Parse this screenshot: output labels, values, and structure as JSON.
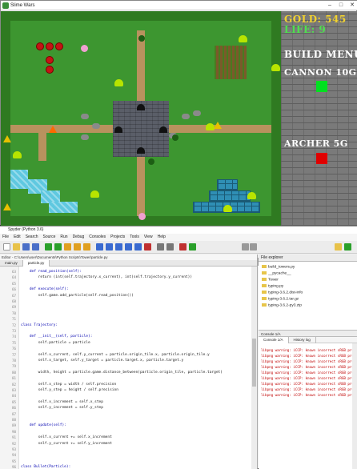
{
  "game_window": {
    "title": "Slime Wars",
    "controls": [
      "–",
      "□",
      "✕"
    ]
  },
  "hud": {
    "gold": "GOLD: 545",
    "life": "LIFE: 9",
    "build_menu": "BUILD MENU:",
    "cannon": "CANNON 10G",
    "archer": "ARCHER 5G",
    "colors": {
      "gold": "#f2d22e",
      "life": "#4fe04f",
      "cannon": "#00e020",
      "archer": "#e00000"
    }
  },
  "ide": {
    "title": "Spyder (Python 3.6)",
    "menu": [
      "File",
      "Edit",
      "Search",
      "Source",
      "Run",
      "Debug",
      "Consoles",
      "Projects",
      "Tools",
      "View",
      "Help"
    ],
    "path": "C:\\Users\\user\\Documents\\Python Scripts",
    "editor_header": "Editor - C:\\Users\\user\\Documents\\Python Scripts\\Tower\\particle.py",
    "tabs": [
      "main.py",
      "particle.py"
    ],
    "line_numbers": [
      "63",
      "64",
      "65",
      "66",
      "67",
      "68",
      "69",
      "70",
      "71",
      "72",
      "73",
      "74",
      "75",
      "76",
      "77",
      "78",
      "79",
      "80",
      "81",
      "82",
      "83",
      "84",
      "85",
      "86",
      "87",
      "88",
      "89",
      "90",
      "91",
      "92",
      "93",
      "94",
      "95",
      "96"
    ],
    "code_lines": [
      "    def read_position(self):",
      "        return (int(self.trajectory.x_current), int(self.trajectory.y_current))",
      "",
      "    def execute(self):",
      "        self.game.add_particle(self.read_position())",
      "",
      "",
      "",
      "",
      "class Trajectory:",
      "",
      "    def __init__(self, particle):",
      "        self.particle = particle",
      "",
      "        self.x_current, self.y_current = particle.origin_tile.x, particle.origin_tile.y",
      "        self.x_target, self.y_target = particle.target.x, particle.target.y",
      "",
      "        width, height = particle.game.distance_between(particle.origin_tile, particle.target)",
      "",
      "        self.x_step = width / self.precision",
      "        self.y_step = height / self.precision",
      "",
      "        self.x_increment = self.x_step",
      "        self.y_increment = self.y_step",
      "",
      "",
      "    def update(self):",
      "",
      "        self.x_current += self.x_increment",
      "        self.y_current += self.y_increment",
      "",
      "",
      "",
      "class Bullet(Particle):"
    ],
    "explorer": {
      "title": "File explorer",
      "items": [
        "build_towers.py",
        "__pycache__",
        "Tower",
        "typing.py",
        "typing-3.6.2.dist-info",
        "typing-3.6.2.tar.gz",
        "typing-3.6.2-py3.zip"
      ]
    },
    "console": {
      "header": "Console 1/A",
      "tabs": [
        "Console 1/A",
        "History log"
      ],
      "lines": [
        "libpng warning: iCCP: known incorrect sRGB profile",
        "libpng warning: iCCP: known incorrect sRGB profile",
        "libpng warning: iCCP: known incorrect sRGB profile",
        "libpng warning: iCCP: known incorrect sRGB profile",
        "libpng warning: iCCP: known incorrect sRGB profile",
        "libpng warning: iCCP: known incorrect sRGB profile",
        "libpng warning: iCCP: known incorrect sRGB profile",
        "libpng warning: iCCP: known incorrect sRGB profile",
        "libpng warning: iCCP: known incorrect sRGB profile"
      ]
    }
  }
}
